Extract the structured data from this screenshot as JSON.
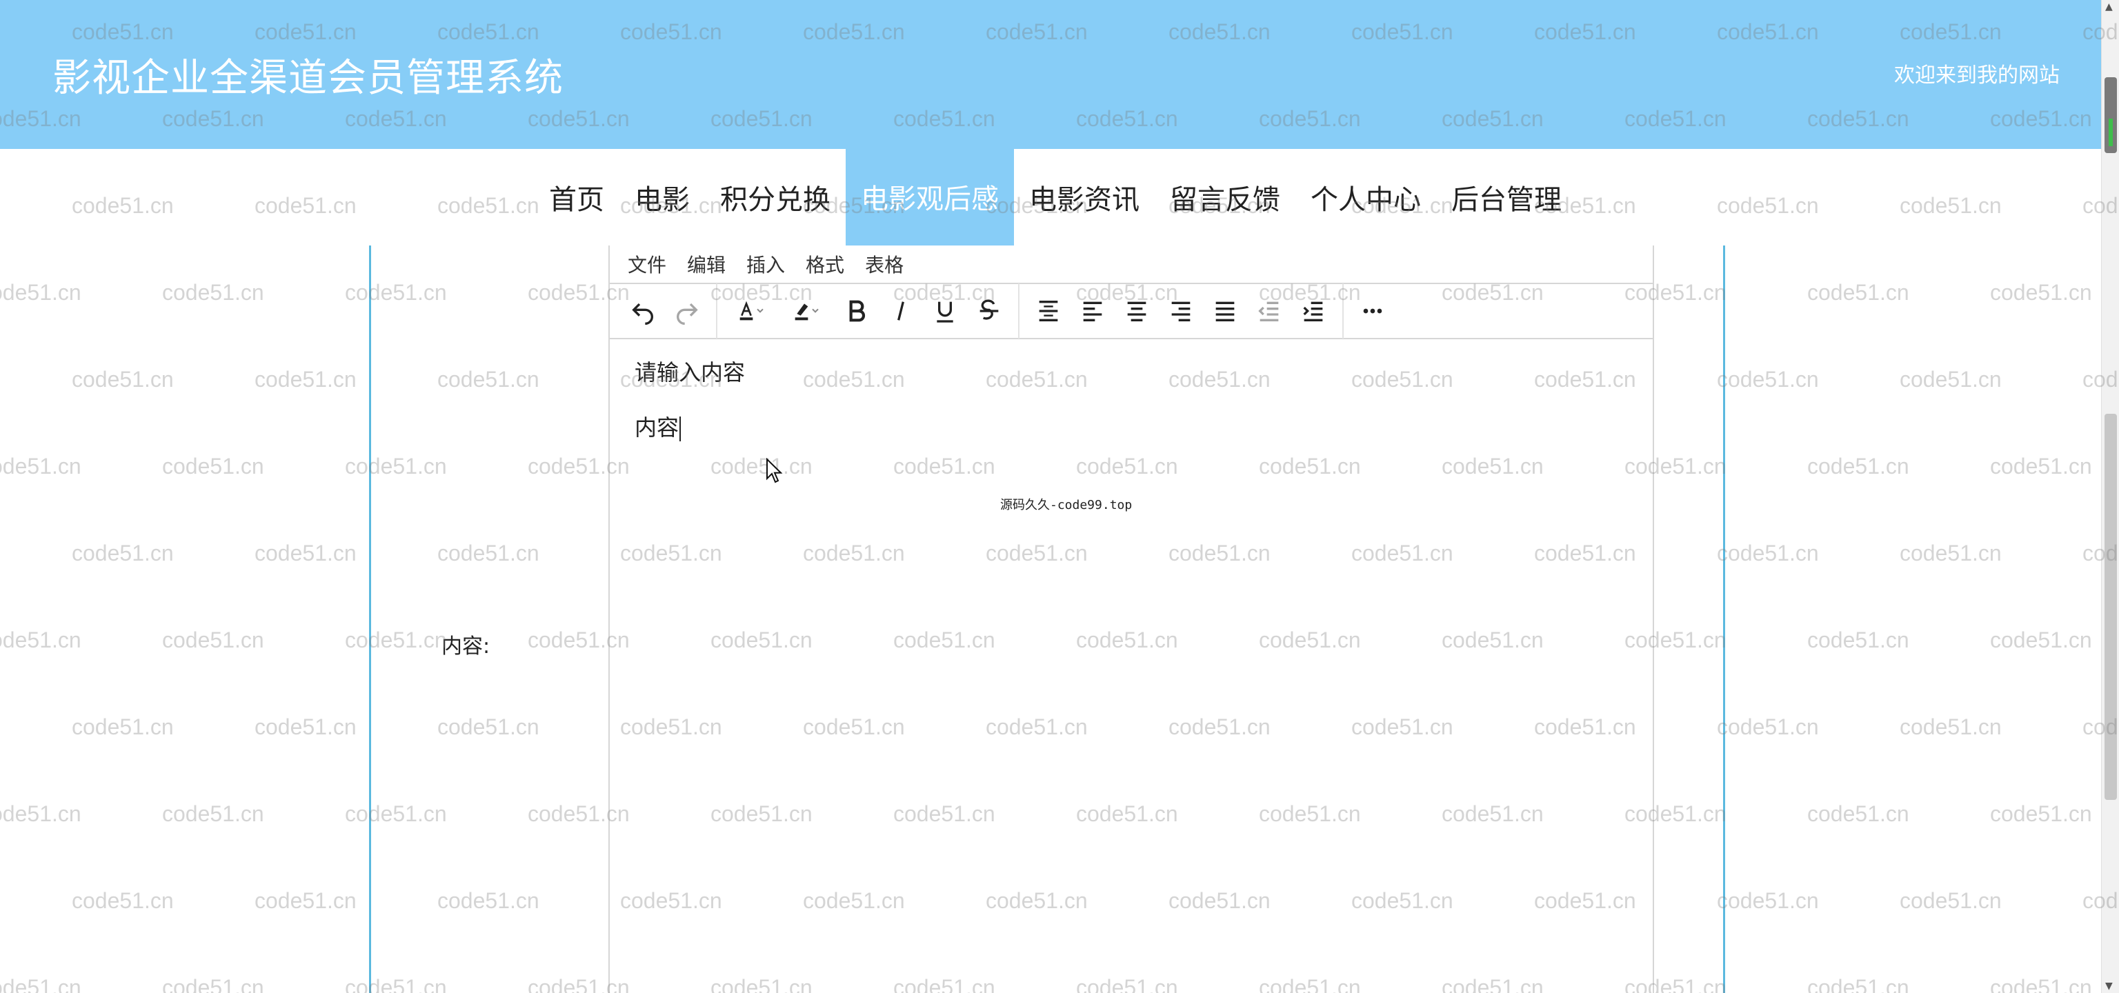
{
  "header": {
    "site_title": "影视企业全渠道会员管理系统",
    "welcome": "欢迎来到我的网站"
  },
  "nav": {
    "items": [
      {
        "label": "首页"
      },
      {
        "label": "电影"
      },
      {
        "label": "积分兑换"
      },
      {
        "label": "电影观后感",
        "active": true
      },
      {
        "label": "电影资讯"
      },
      {
        "label": "留言反馈"
      },
      {
        "label": "个人中心"
      },
      {
        "label": "后台管理"
      }
    ]
  },
  "form": {
    "content_label": "内容:"
  },
  "editor": {
    "menu": [
      "文件",
      "编辑",
      "插入",
      "格式",
      "表格"
    ],
    "toolbar_icons": [
      "undo-icon",
      "redo-icon",
      "text-color-icon",
      "highlight-color-icon",
      "bold-icon",
      "italic-icon",
      "underline-icon",
      "strikethrough-icon",
      "line-height-icon",
      "align-left-icon",
      "align-center-icon",
      "align-right-icon",
      "align-justify-icon",
      "outdent-icon",
      "indent-icon",
      "more-icon"
    ],
    "placeholder_line": "请输入内容",
    "typed_text": "内容"
  },
  "source_note": "源码久久-code99.top",
  "watermark": "code51.cn",
  "colors": {
    "header_bg": "#87cdf7",
    "frame_line": "#5bb9df",
    "text": "#222222"
  }
}
